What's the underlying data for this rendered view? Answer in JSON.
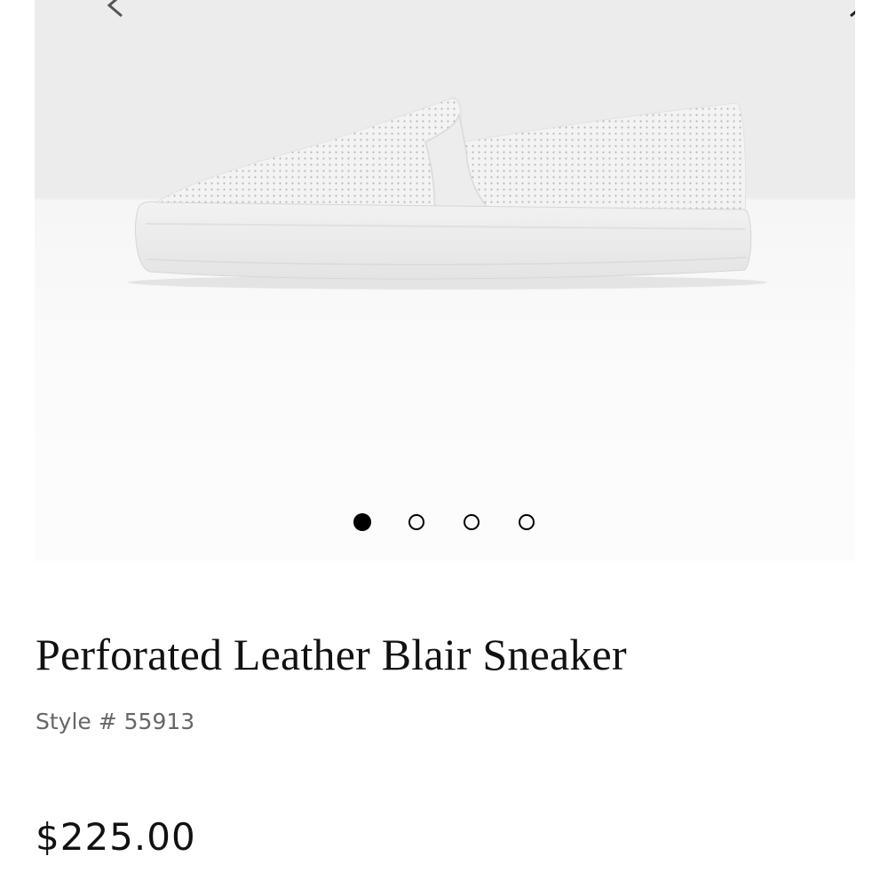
{
  "gallery": {
    "image_alt": "white perforated slip-on sneaker",
    "prev_icon": "chevron-left-icon",
    "next_icon": "chevron-right-icon",
    "pages": 4,
    "active_page": 1
  },
  "product": {
    "title": "Perforated Leather Blair Sneaker",
    "style_number": "Style # 55913",
    "price": "$225.00"
  },
  "colors": {
    "backdrop": "#ececec",
    "text": "#111111",
    "muted": "#666666"
  }
}
